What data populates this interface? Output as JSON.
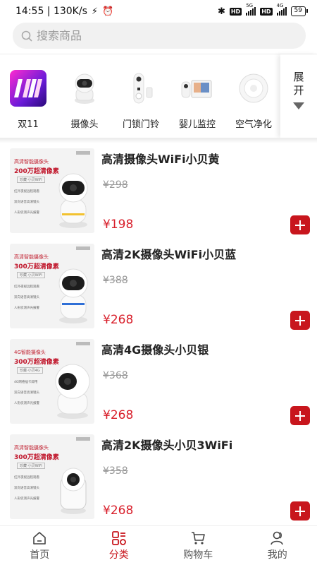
{
  "status_bar": {
    "time_speed": "14:55 | 130K/s",
    "net_5g": "5G",
    "net_4g": "4G",
    "hd": "HD",
    "battery": "59"
  },
  "search": {
    "placeholder": "搜索商品"
  },
  "categories": [
    {
      "label": "双11",
      "icon": "double11-logo"
    },
    {
      "label": "摄像头",
      "icon": "camera"
    },
    {
      "label": "门锁门铃",
      "icon": "doorbell"
    },
    {
      "label": "婴儿监控",
      "icon": "baby-monitor"
    },
    {
      "label": "空气净化",
      "icon": "air-purifier"
    }
  ],
  "expand": {
    "label": "展开"
  },
  "products": [
    {
      "title": "高清摄像头WiFi小贝黄",
      "old_price": "¥298",
      "price": "¥198",
      "thumb": {
        "line1": "高清智能摄像头",
        "line2": "200万超清像素",
        "tag": "珍藏·小贝WiFi",
        "bullets": [
          "红外夜视远程观看",
          "双向语音高清镜头",
          "人形侦测声光报警"
        ],
        "accent": "#f2c230"
      }
    },
    {
      "title": "高清2K摄像头WiFi小贝蓝",
      "old_price": "¥388",
      "price": "¥268",
      "thumb": {
        "line1": "高清智能摄像头",
        "line2": "300万超清像素",
        "tag": "珍藏·小贝WiFi",
        "bullets": [
          "红外夜视远程观看",
          "双向语音高清镜头",
          "人形侦测声光报警"
        ],
        "accent": "#2f6fd6"
      }
    },
    {
      "title": "高清4G摄像头小贝银",
      "old_price": "¥368",
      "price": "¥268",
      "thumb": {
        "line1": "4G智能摄像头",
        "line2": "300万超清像素",
        "tag": "珍藏·小贝4G",
        "bullets": [
          "4G网络插卡即用",
          "双向语音高清镜头",
          "人形侦测声光报警"
        ],
        "accent": "#c8c8c8"
      }
    },
    {
      "title": "高清2K摄像头小贝3WiFi",
      "old_price": "¥358",
      "price": "¥268",
      "thumb": {
        "line1": "高清智能摄像头",
        "line2": "300万超清像素",
        "tag": "珍藏·小贝WiFi",
        "bullets": [
          "红外夜视远程观看",
          "双向语音高清镜头",
          "人形侦测声光报警"
        ],
        "accent": "#dddddd"
      }
    }
  ],
  "tabbar": {
    "items": [
      {
        "label": "首页",
        "icon": "home-icon",
        "active": false
      },
      {
        "label": "分类",
        "icon": "category-icon",
        "active": true
      },
      {
        "label": "购物车",
        "icon": "cart-icon",
        "active": false
      },
      {
        "label": "我的",
        "icon": "profile-icon",
        "active": false
      }
    ]
  },
  "colors": {
    "accent": "#c8161d",
    "price": "#d81e2a",
    "search_bg": "#f1f1f1"
  }
}
